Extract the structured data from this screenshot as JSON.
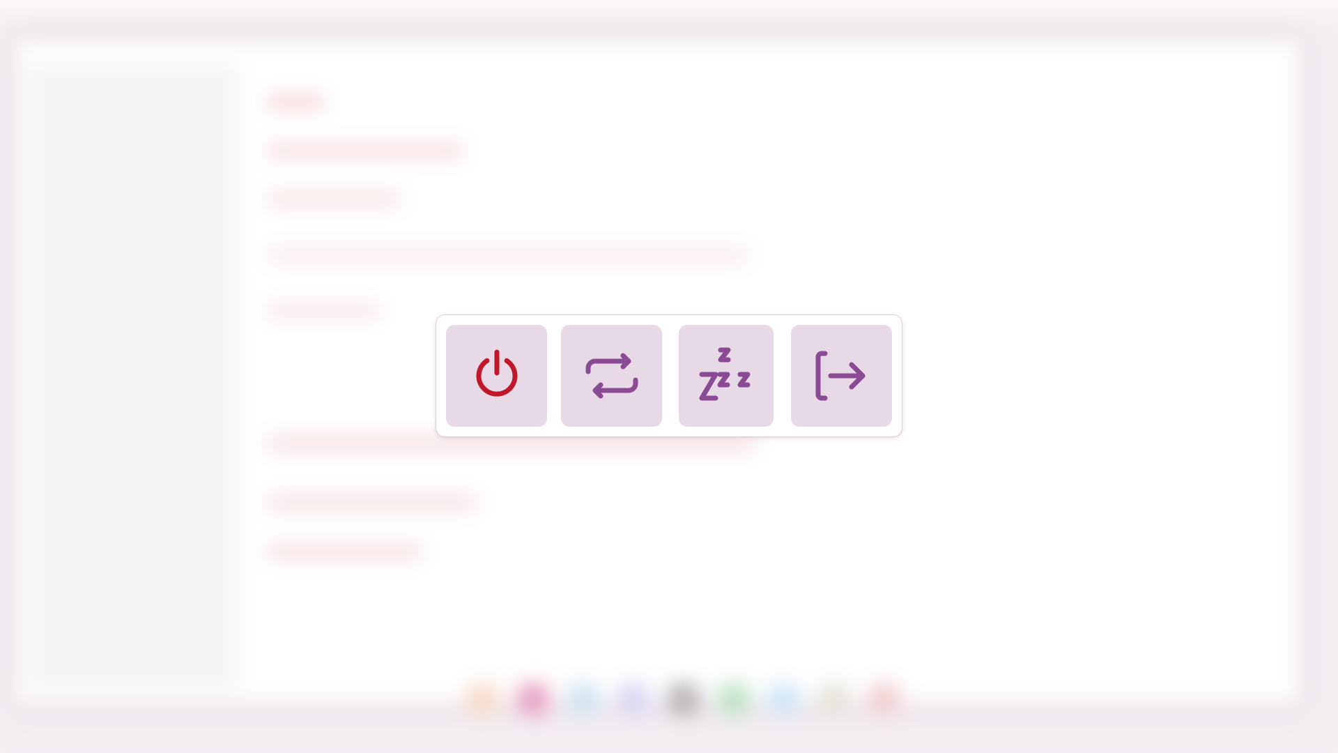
{
  "power_menu": {
    "buttons": [
      {
        "id": "shutdown",
        "icon": "power-icon",
        "color": "#c0182a"
      },
      {
        "id": "restart",
        "icon": "restart-icon",
        "color": "#8a4a94"
      },
      {
        "id": "suspend",
        "icon": "sleep-zzz-icon",
        "color": "#8a4a94"
      },
      {
        "id": "logout",
        "icon": "logout-icon",
        "color": "#8a4a94"
      }
    ],
    "button_background": "#e8d9e6",
    "panel_background": "#ffffff"
  },
  "theme": {
    "desktop_background": "#f6f1f5",
    "accent": "#8a4a94",
    "danger": "#c0182a"
  }
}
